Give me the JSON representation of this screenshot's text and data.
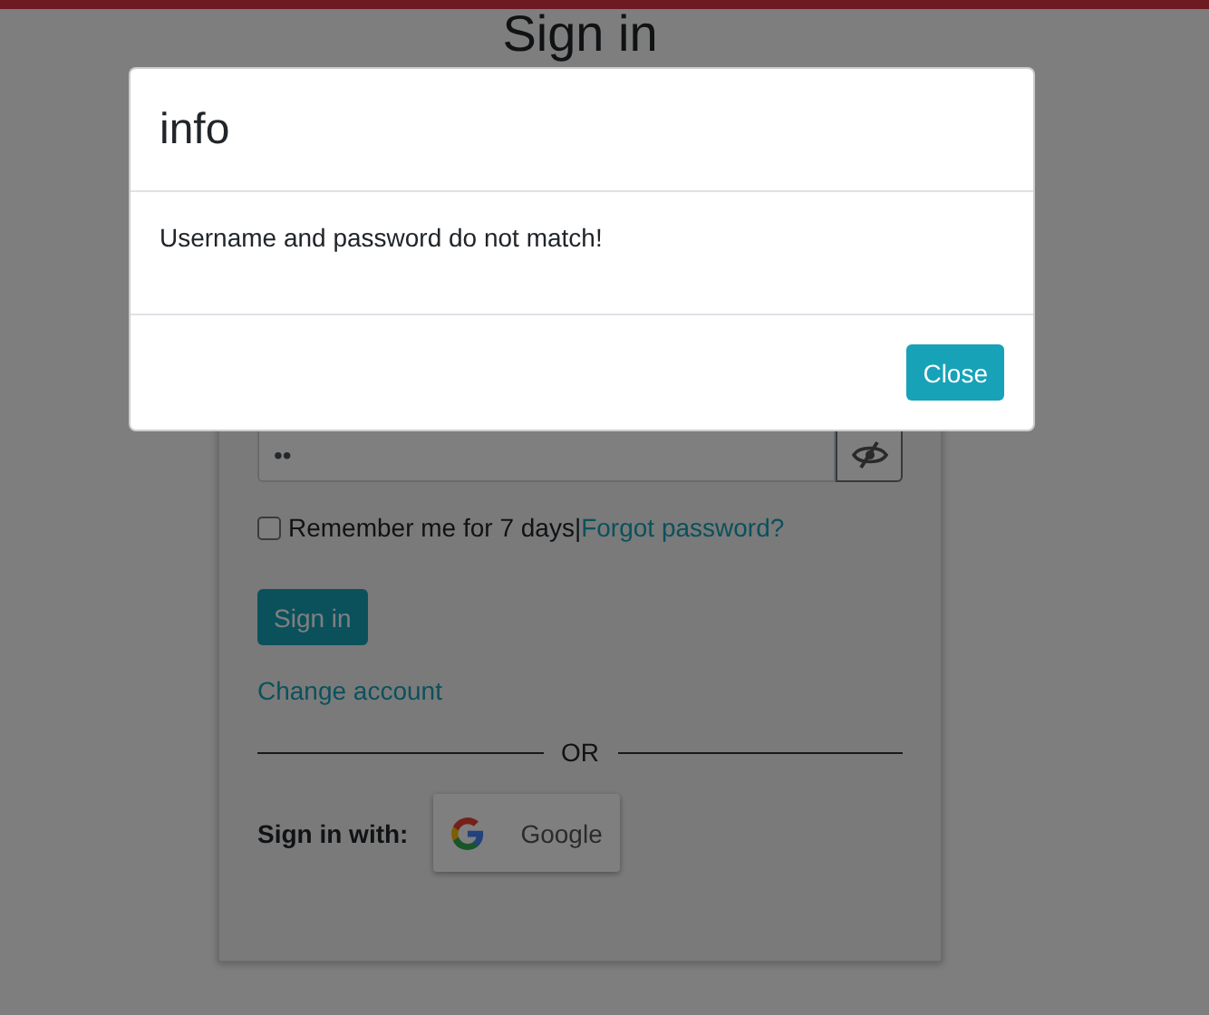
{
  "page": {
    "title": "Sign in"
  },
  "form": {
    "password": {
      "value": "••"
    },
    "remember": {
      "label": "Remember me for 7 days",
      "checked": false
    },
    "separator": "|",
    "forgot_link": "Forgot password?",
    "submit": "Sign in",
    "change_account": "Change account",
    "divider": "OR",
    "sign_in_with": "Sign in with:",
    "providers": [
      {
        "label": "Google"
      }
    ]
  },
  "modal": {
    "title": "info",
    "message": "Username and password do not match!",
    "buttons": [
      "Close"
    ]
  }
}
